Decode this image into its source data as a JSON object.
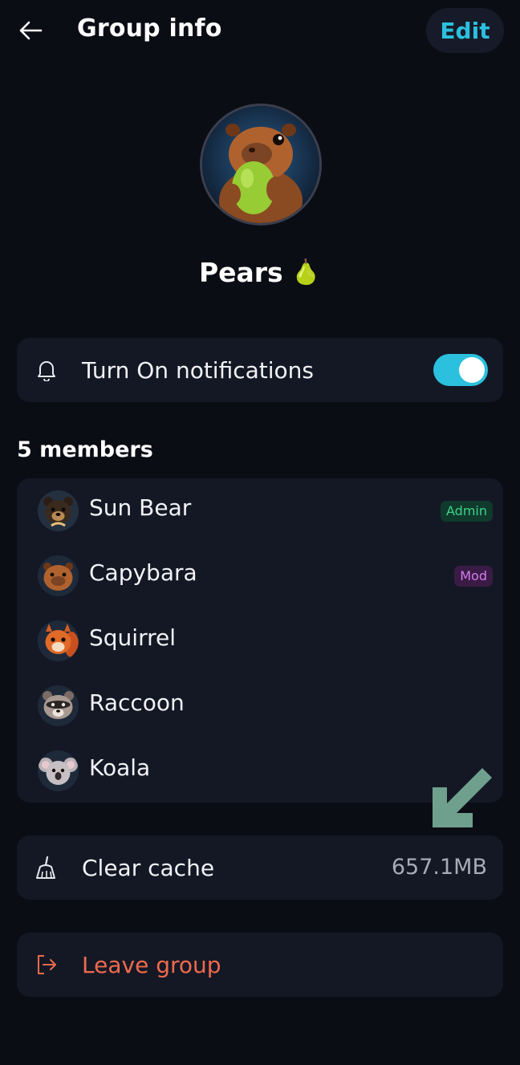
{
  "header": {
    "title": "Group info",
    "edit_label": "Edit"
  },
  "group": {
    "name": "Pears",
    "emoji": "🍐"
  },
  "notifications": {
    "label": "Turn On notifications",
    "enabled": true
  },
  "members": {
    "heading": "5 members",
    "items": [
      {
        "name": "Sun Bear",
        "badge": "Admin",
        "avatar": "sun-bear"
      },
      {
        "name": "Capybara",
        "badge": "Mod",
        "avatar": "capybara"
      },
      {
        "name": "Squirrel",
        "badge": "",
        "avatar": "squirrel"
      },
      {
        "name": "Raccoon",
        "badge": "",
        "avatar": "raccoon"
      },
      {
        "name": "Koala",
        "badge": "",
        "avatar": "koala"
      }
    ]
  },
  "cache": {
    "label": "Clear cache",
    "size": "657.1MB"
  },
  "leave": {
    "label": "Leave group"
  },
  "icons": {
    "back": "arrow-left-icon",
    "bell": "bell-icon",
    "broom": "broom-icon",
    "exit": "exit-icon",
    "pointer": "arrow-down-left-icon"
  },
  "colors": {
    "background": "#0b0d15",
    "card": "#141824",
    "accent": "#2bc0de",
    "danger": "#ef6a4e",
    "admin_badge": "#3ed28a",
    "mod_badge": "#d67df0",
    "pointer_arrow": "#6fa08e"
  }
}
